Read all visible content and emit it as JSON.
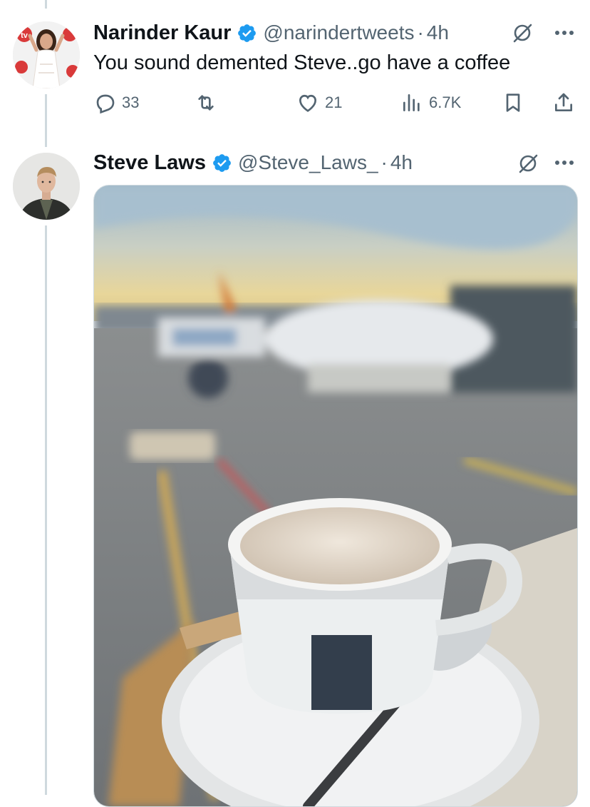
{
  "tweets": [
    {
      "display_name": "Narinder Kaur",
      "handle": "@narindertweets",
      "separator": "·",
      "time": "4h",
      "text": "You sound demented Steve..go have a coffee",
      "stats": {
        "replies": "33",
        "likes": "21",
        "views": "6.7K"
      },
      "avatar_badge_text": "tv"
    },
    {
      "display_name": "Steve Laws",
      "handle": "@Steve_Laws_",
      "separator": "·",
      "time": "4h",
      "media_description_icon": "photo-airport-coffee"
    }
  ],
  "colors": {
    "verified": "#1d9bf0",
    "text_primary": "#0f1419",
    "text_secondary": "#536471",
    "thread_line": "#cfd9de"
  }
}
